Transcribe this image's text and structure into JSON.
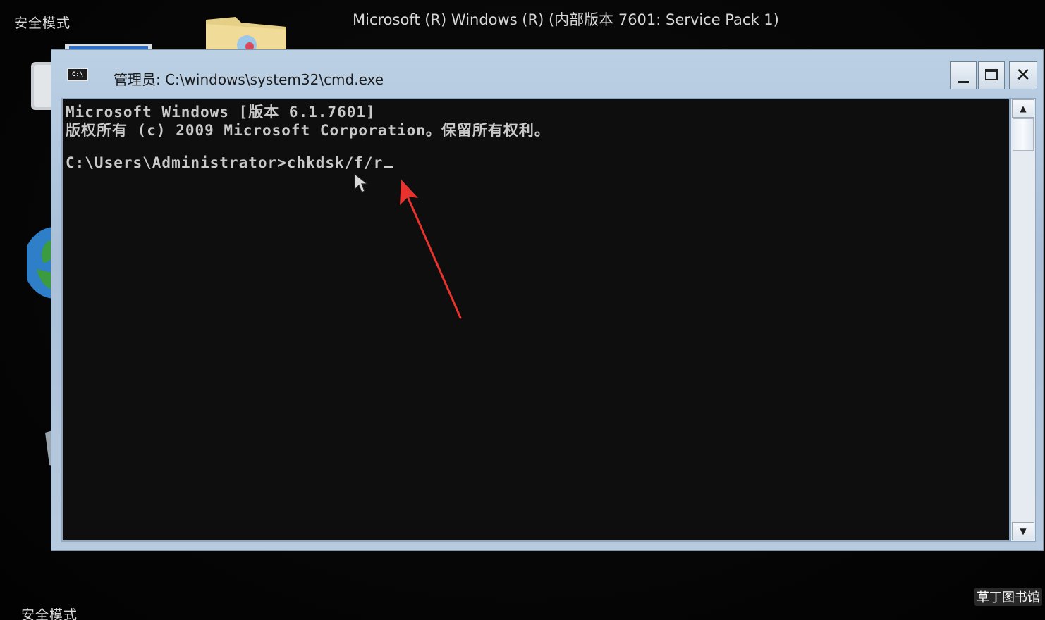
{
  "desktop": {
    "safe_mode_top": "安全模式",
    "safe_mode_bottom": "安全模式",
    "title": "Microsoft (R) Windows (R) (内部版本 7601: Service Pack 1)"
  },
  "window": {
    "title": "管理员: C:\\windows\\system32\\cmd.exe",
    "icon_label": "C:\\",
    "icon_name": "cmd-icon",
    "buttons": {
      "minimize_icon": "minimize-icon",
      "maximize_icon": "maximize-icon",
      "close_icon": "close-icon",
      "close_glyph": "✕"
    }
  },
  "console": {
    "lines": [
      "Microsoft Windows [版本 6.1.7601]",
      "版权所有 (c) 2009 Microsoft Corporation。保留所有权利。",
      "",
      "C:\\Users\\Administrator>chkdsk/f/r"
    ]
  },
  "scrollbar": {
    "up_glyph": "▲",
    "down_glyph": "▼"
  },
  "annotation": {
    "arrow_color": "#e8322e"
  },
  "watermark": {
    "text": "草丁图书馆"
  },
  "colors": {
    "console_bg": "#0e0e0e",
    "console_text": "#c9c9c9",
    "window_frame": "#b7cade"
  }
}
